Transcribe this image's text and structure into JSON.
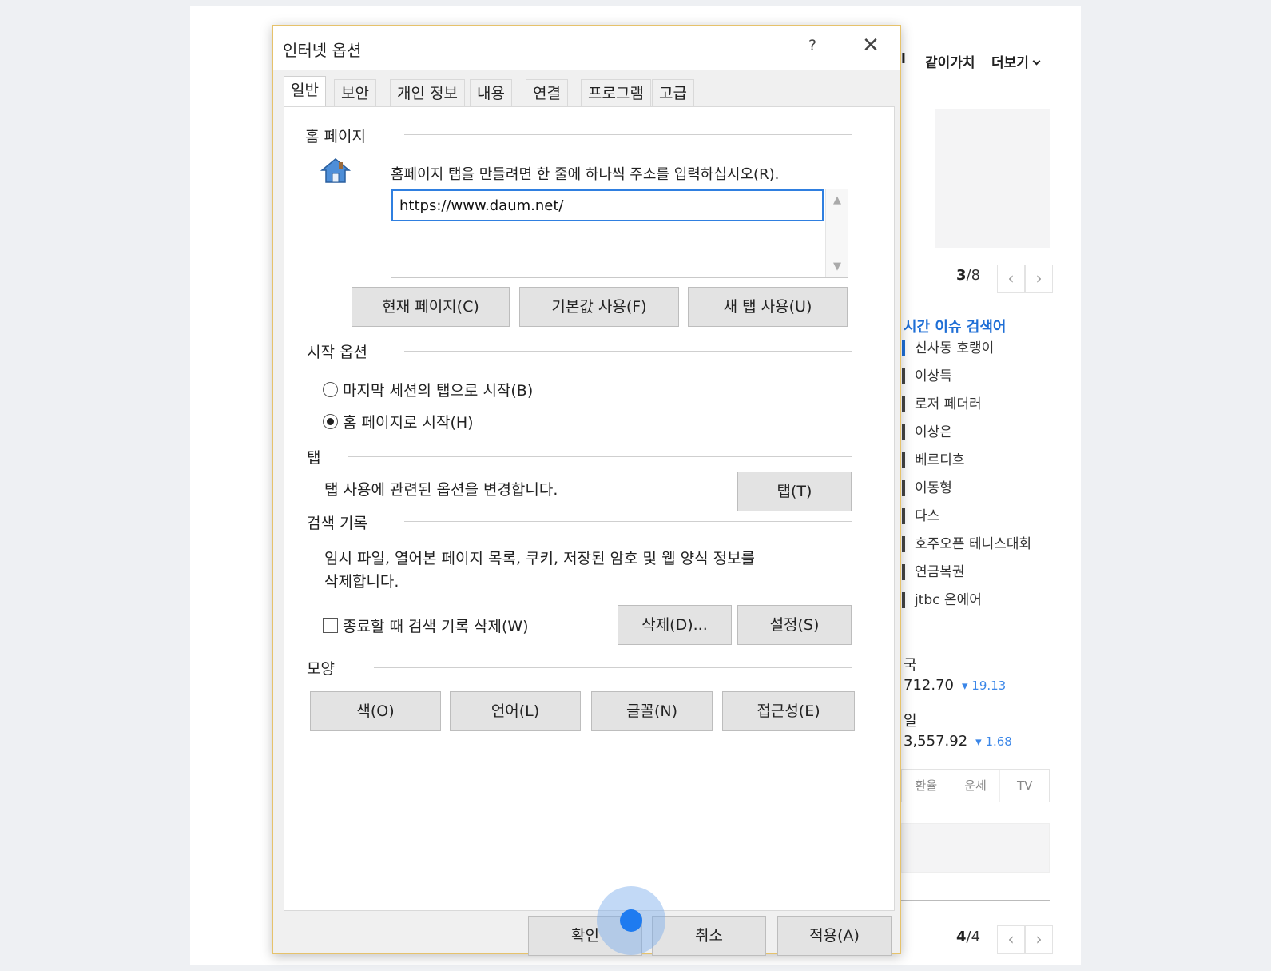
{
  "background": {
    "nav": [
      "l",
      "같이가치",
      "더보기"
    ],
    "pager_top": {
      "current": "3",
      "total": "/8"
    },
    "pager_bottom": {
      "current": "4",
      "total": "/4"
    },
    "realtime_title": "시간 이슈 검색어",
    "realtime_items": [
      "신사동 호랭이",
      "이상득",
      "로저 페더러",
      "이상은",
      "베르디흐",
      "이동형",
      "다스",
      "호주오픈 테니스대회",
      "연금복권",
      "jtbc 온에어"
    ],
    "stocks": [
      {
        "name": "국",
        "value": "712.70",
        "change": "▾ 19.13"
      },
      {
        "name": "일",
        "value": "3,557.92",
        "change": "▾ 1.68"
      }
    ],
    "service_tabs": [
      "환율",
      "운세",
      "TV"
    ],
    "pager_arrows": {
      "prev": "‹",
      "next": "›"
    }
  },
  "dialog": {
    "title": "인터넷 옵션",
    "help": "?",
    "close": "✕",
    "tabs": [
      "일반",
      "보안",
      "개인 정보",
      "내용",
      "연결",
      "프로그램",
      "고급"
    ],
    "homepage": {
      "label": "홈 페이지",
      "description": "홈페이지 탭을 만들려면 한 줄에 하나씩 주소를 입력하십시오(R).",
      "url": "https://www.daum.net/",
      "buttons": [
        "현재 페이지(C)",
        "기본값 사용(F)",
        "새 탭 사용(U)"
      ]
    },
    "startup": {
      "label": "시작 옵션",
      "options": [
        "마지막 세션의 탭으로 시작(B)",
        "홈 페이지로 시작(H)"
      ],
      "selected_index": 1
    },
    "tabs_group": {
      "label": "탭",
      "description": "탭 사용에 관련된 옵션을 변경합니다.",
      "button": "탭(T)"
    },
    "history": {
      "label": "검색 기록",
      "description_line1": "임시 파일, 열어본 페이지 목록, 쿠키, 저장된 암호 및 웹 양식 정보를",
      "description_line2": "삭제합니다.",
      "checkbox": "종료할 때 검색 기록 삭제(W)",
      "checked": false,
      "delete_button": "삭제(D)...",
      "settings_button": "설정(S)"
    },
    "appearance": {
      "label": "모양",
      "buttons": [
        "색(O)",
        "언어(L)",
        "글꼴(N)",
        "접근성(E)"
      ]
    },
    "footer": {
      "ok": "확인",
      "cancel": "취소",
      "apply": "적용(A)"
    }
  }
}
